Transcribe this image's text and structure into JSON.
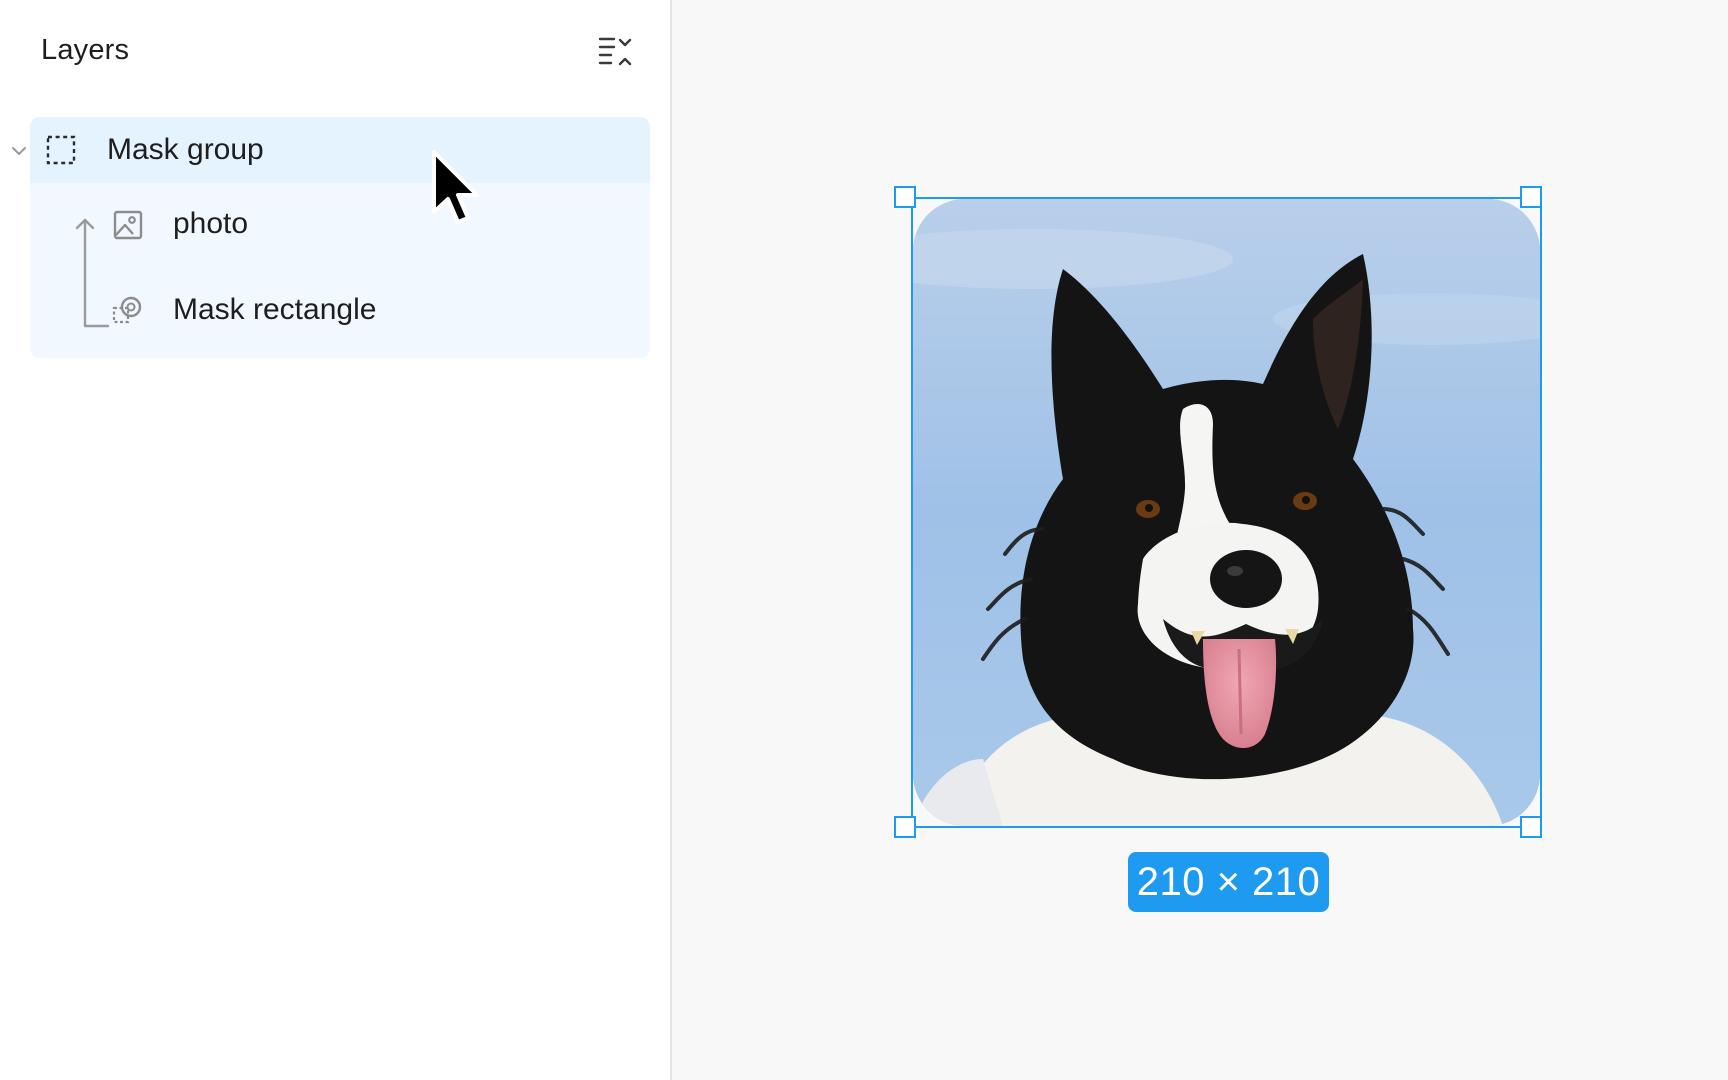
{
  "panel": {
    "title": "Layers",
    "menu_icon": "collapse-layers-icon"
  },
  "layers": [
    {
      "label": "Mask group",
      "icon": "mask-group-icon",
      "selected": true,
      "expanded": true
    },
    {
      "label": "photo",
      "icon": "image-icon",
      "selected": false
    },
    {
      "label": "Mask rectangle",
      "icon": "mask-shape-icon",
      "selected": false
    }
  ],
  "canvas": {
    "selection_size": "210 × 210",
    "photo_subject": "dog-photo"
  },
  "colors": {
    "accent": "#1e9bf0",
    "selected_row": "#e5f3ff",
    "group_bg": "#f2f8ff",
    "text": "#1e1e1e",
    "icon": "#8c8c8c"
  }
}
